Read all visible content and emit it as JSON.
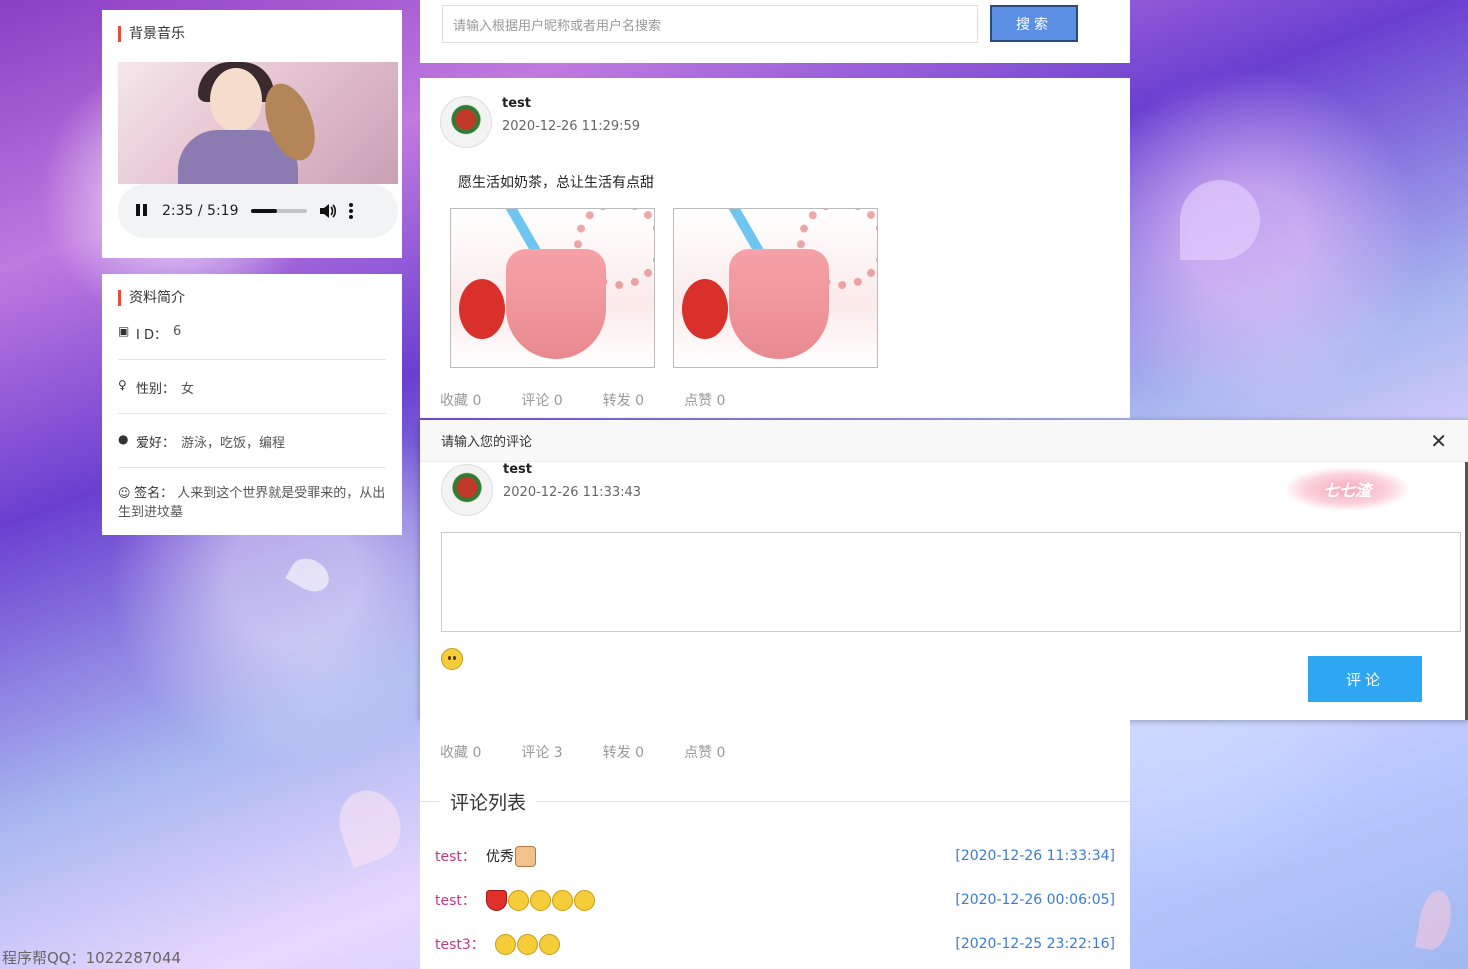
{
  "music": {
    "title": "背景音乐",
    "time": "2:35 / 5:19",
    "progress": 0.48
  },
  "profile": {
    "title": "资料简介",
    "rows": [
      {
        "icon": "id-card-icon",
        "label": "I D：",
        "value": "6"
      },
      {
        "icon": "gender-icon",
        "label": "性别：",
        "value": "女"
      },
      {
        "icon": "map-pin-icon",
        "label": "爱好：",
        "value": "游泳，吃饭，编程"
      },
      {
        "icon": "smile-icon",
        "label": "签名：",
        "value": "人来到这个世界就是受罪来的，从出生到进坟墓"
      }
    ]
  },
  "search": {
    "placeholder": "请输入根据用户昵称或者用户名搜索",
    "button": "搜索"
  },
  "post": {
    "user": "test",
    "time": "2020-12-26 11:29:59",
    "text": "愿生活如奶茶，总让生活有点甜",
    "stats": {
      "favorite": "收藏 0",
      "comment": "评论 0",
      "forward": "转发 0",
      "like": "点赞 0"
    }
  },
  "modal": {
    "title": "请输入您的评论",
    "user": "test",
    "time": "2020-12-26 11:33:43",
    "badge": "七七渣",
    "submit": "评论"
  },
  "post2": {
    "stats": {
      "favorite": "收藏 0",
      "comment": "评论 3",
      "forward": "转发 0",
      "like": "点赞 0"
    }
  },
  "comments": {
    "legend": "评论列表",
    "items": [
      {
        "name": "test：",
        "text": "优秀",
        "emojis": [
          "thumbs-up-emoji"
        ],
        "time": "[2020-12-26 11:33:34]"
      },
      {
        "name": "test：",
        "text": "",
        "emojis": [
          "heart-emoji",
          "angry-emoji",
          "crying-emoji",
          "shocked-emoji",
          "wink-emoji"
        ],
        "time": "[2020-12-26 00:06:05]"
      },
      {
        "name": "test3：",
        "text": "",
        "emojis": [
          "smile-emoji",
          "surprised-emoji",
          "smirk-emoji"
        ],
        "time": "[2020-12-25 23:22:16]"
      }
    ]
  },
  "watermark": "程序帮QQ：1022287044",
  "colors": {
    "accent": "#e74c3c",
    "button": "#2ea6f1",
    "search_button": "#5b8fe3",
    "comment_name": "#c0398a",
    "comment_time": "#3a7bd5"
  }
}
